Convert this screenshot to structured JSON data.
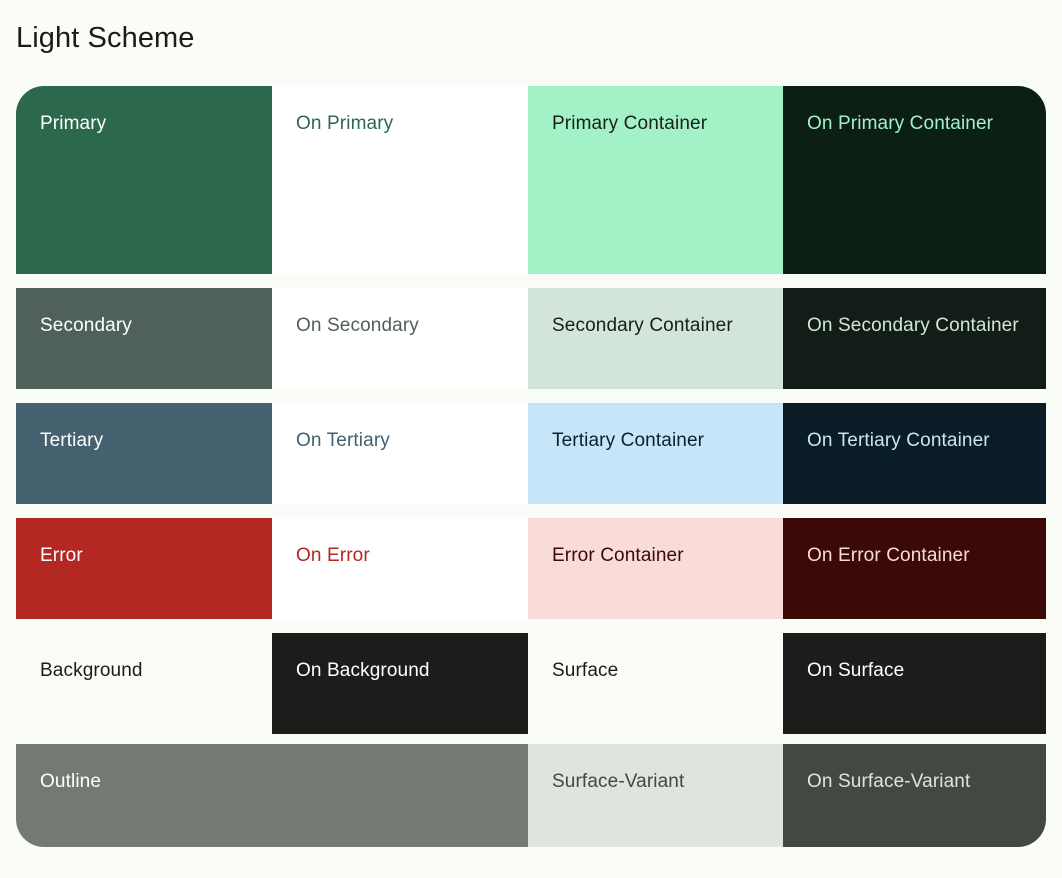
{
  "title": "Light Scheme",
  "page": {
    "background_color": "#FAFCF7",
    "title_color": "#1A1C19"
  },
  "rows": [
    {
      "name": "primary",
      "cells": [
        {
          "label": "Primary",
          "bg": "#2C684B",
          "fg": "#FFFFFF"
        },
        {
          "label": "On Primary",
          "bg": "#FFFFFF",
          "fg": "#2C684B"
        },
        {
          "label": "Primary Container",
          "bg": "#A3F2C7",
          "fg": "#17201B"
        },
        {
          "label": "On Primary Container",
          "bg": "#0C1F14",
          "fg": "#A3F2C7"
        }
      ]
    },
    {
      "name": "secondary",
      "cells": [
        {
          "label": "Secondary",
          "bg": "#50605A",
          "fg": "#FFFFFF"
        },
        {
          "label": "On Secondary",
          "bg": "#FFFFFF",
          "fg": "#50605A"
        },
        {
          "label": "Secondary Container",
          "bg": "#D3E5D8",
          "fg": "#1A1C19"
        },
        {
          "label": "On Secondary Container",
          "bg": "#131D18",
          "fg": "#D3E5D8"
        }
      ]
    },
    {
      "name": "tertiary",
      "cells": [
        {
          "label": "Tertiary",
          "bg": "#45606E",
          "fg": "#FFFFFF"
        },
        {
          "label": "On Tertiary",
          "bg": "#FFFFFF",
          "fg": "#45606E"
        },
        {
          "label": "Tertiary Container",
          "bg": "#C7E5F8",
          "fg": "#0D1F28"
        },
        {
          "label": "On Tertiary Container",
          "bg": "#0A1C25",
          "fg": "#C7E5F8"
        }
      ]
    },
    {
      "name": "error",
      "cells": [
        {
          "label": "Error",
          "bg": "#B32822",
          "fg": "#FFFFFF"
        },
        {
          "label": "On Error",
          "bg": "#FFFFFF",
          "fg": "#B32822"
        },
        {
          "label": "Error Container",
          "bg": "#F9DCD9",
          "fg": "#3B0906"
        },
        {
          "label": "On Error Container",
          "bg": "#3B0906",
          "fg": "#F9DCD9"
        }
      ]
    },
    {
      "name": "surface",
      "cells": [
        {
          "label": "Background",
          "bg": "#FAFCF7",
          "fg": "#1A1C19"
        },
        {
          "label": "On Background",
          "bg": "#1C1D1B",
          "fg": "#FFFFFF"
        },
        {
          "label": "Surface",
          "bg": "#FAFCF7",
          "fg": "#1A1C19"
        },
        {
          "label": "On Surface",
          "bg": "#1C1D1B",
          "fg": "#FFFFFF"
        }
      ]
    },
    {
      "name": "outline",
      "cells": [
        {
          "label": "Outline",
          "bg": "#737A74",
          "fg": "#FFFFFF",
          "span": 2
        },
        {
          "label": "Surface-Variant",
          "bg": "#DDE5DE",
          "fg": "#414941"
        },
        {
          "label": "On Surface-Variant",
          "bg": "#414941",
          "fg": "#DDE5DE"
        }
      ]
    }
  ]
}
